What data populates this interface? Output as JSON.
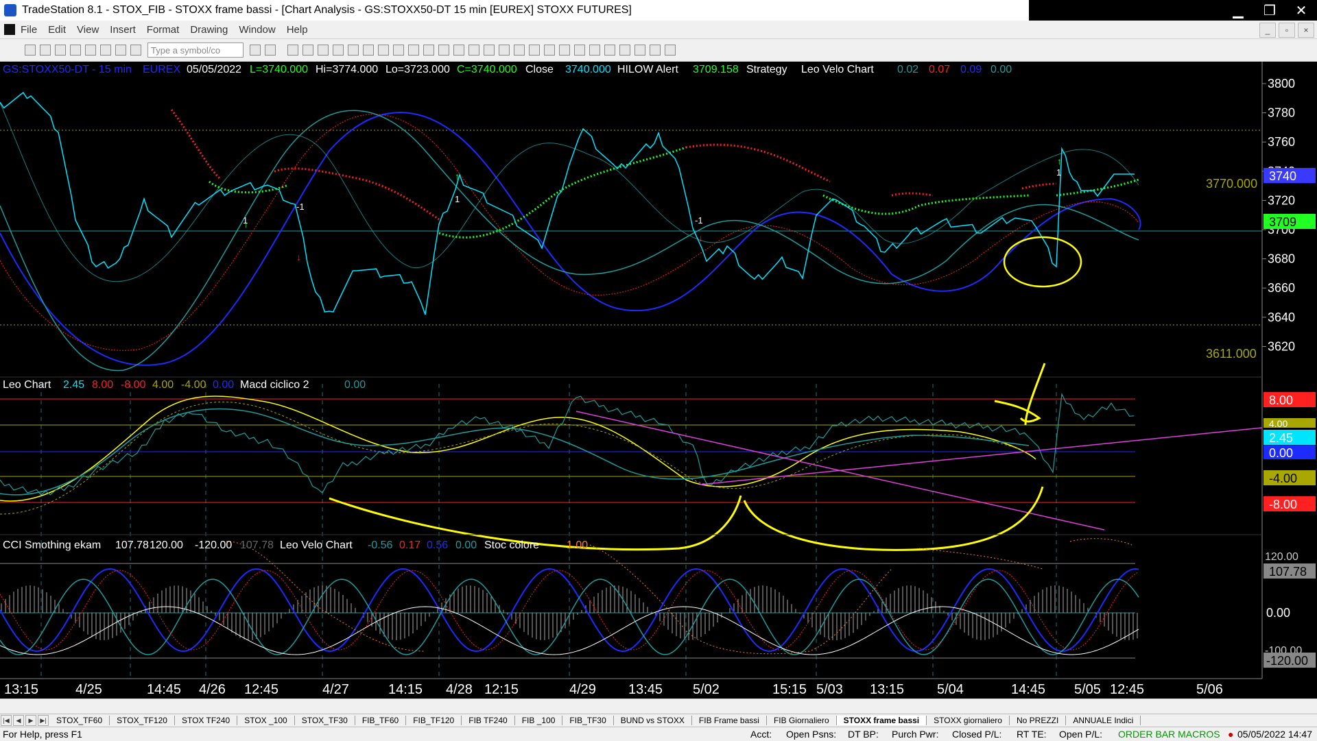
{
  "window": {
    "title": "TradeStation 8.1 - STOX_FIB - STOXX frame bassi - [Chart Analysis - GS:STOXX50-DT  15 min  [EUREX] STOXX FUTURES]",
    "minimize": "▁",
    "restore": "❐",
    "close": "✕"
  },
  "menu": [
    "File",
    "Edit",
    "View",
    "Insert",
    "Format",
    "Drawing",
    "Window",
    "Help"
  ],
  "toolbar": {
    "symbol_placeholder": "Type a symbol/co"
  },
  "header": {
    "symbol": "GS:STOXX50-DT - 15 min",
    "exchange": "EUREX",
    "date": "05/05/2022",
    "last": "L=3740.000",
    "hi": "Hi=3774.000",
    "lo": "Lo=3723.000",
    "close_eq": "C=3740.000",
    "close_label": "Close",
    "close_val": "3740.000",
    "hilow": "HILOW Alert",
    "hilow_val": "3709.158",
    "strategy": "Strategy",
    "leo_velo": "Leo Velo Chart",
    "v1": "0.02",
    "v2": "0.07",
    "v3": "0.09",
    "v4": "0.00"
  },
  "price_panel": {
    "axis": [
      "3800",
      "3780",
      "3760",
      "3740",
      "3720",
      "3700",
      "3680",
      "3660",
      "3640",
      "3620"
    ],
    "line_hi": "3770.000",
    "line_lo": "3611.000",
    "tag_last": "3740",
    "tag_hilow": "3709",
    "arrow_labels": [
      "1",
      "-1",
      "1",
      "-1",
      "1"
    ]
  },
  "macd_panel": {
    "name": "Leo Chart",
    "v1": "2.45",
    "v2": "8.00",
    "v3": "-8.00",
    "v4": "4.00",
    "v5": "-4.00",
    "v6": "0.00",
    "name2": "Macd ciclico 2",
    "v7": "0.00",
    "tags": [
      "8.00",
      "4.00",
      "2.45",
      "0.00",
      "-4.00",
      "-8.00"
    ]
  },
  "cci_panel": {
    "name": "CCI Smothing ekam",
    "v1": "107.78",
    "v2": "120.00",
    "v3": "-120.00",
    "v4": "107.78",
    "name2": "Leo Velo Chart",
    "v5": "-0.56",
    "v6": "0.17",
    "v7": "0.56",
    "v8": "0.00",
    "name3": "Stoc colore",
    "v9": "1.00",
    "tags": [
      "120.00",
      "107.78",
      "0.00",
      "-100.00",
      "-120.00"
    ]
  },
  "time_axis": [
    "13:15",
    "4/25",
    "14:45",
    "4/26",
    "12:45",
    "4/27",
    "14:15",
    "4/28",
    "12:15",
    "4/29",
    "13:45",
    "5/02",
    "15:15",
    "5/03",
    "13:15",
    "5/04",
    "14:45",
    "5/05",
    "12:45",
    "5/06"
  ],
  "tabs": [
    "STOX_TF60",
    "STOX_TF120",
    "STOX TF240",
    "STOX _100",
    "STOX_TF30",
    "FIB_TF60",
    "FIB_TF120",
    "FIB TF240",
    "FIB _100",
    "FIB_TF30",
    "BUND vs STOXX",
    "FIB Frame bassi",
    "FIB Giornaliero",
    "STOXX frame bassi",
    "STOXX giornaliero",
    "No PREZZI",
    "ANNUALE Indici"
  ],
  "active_tab": "STOXX frame bassi",
  "status": {
    "help": "For Help, press F1",
    "acct": "Acct:",
    "open_psns": "Open Psns:",
    "dt_bp": "DT BP:",
    "purch_pwr": "Purch Pwr:",
    "closed_pl": "Closed P/L:",
    "rt_te": "RT TE:",
    "open_pl": "Open P/L:",
    "macros": "ORDER BAR  MACROS",
    "datetime": "05/05/2022 14:47"
  },
  "colors": {
    "cyan": "#00e5ff",
    "teal": "#1f9d9d",
    "blue": "#1e2bff",
    "red": "#ff2020",
    "green": "#22ff22",
    "yellow": "#ffff00",
    "magenta": "#e040e0",
    "olive": "#a8a800"
  }
}
